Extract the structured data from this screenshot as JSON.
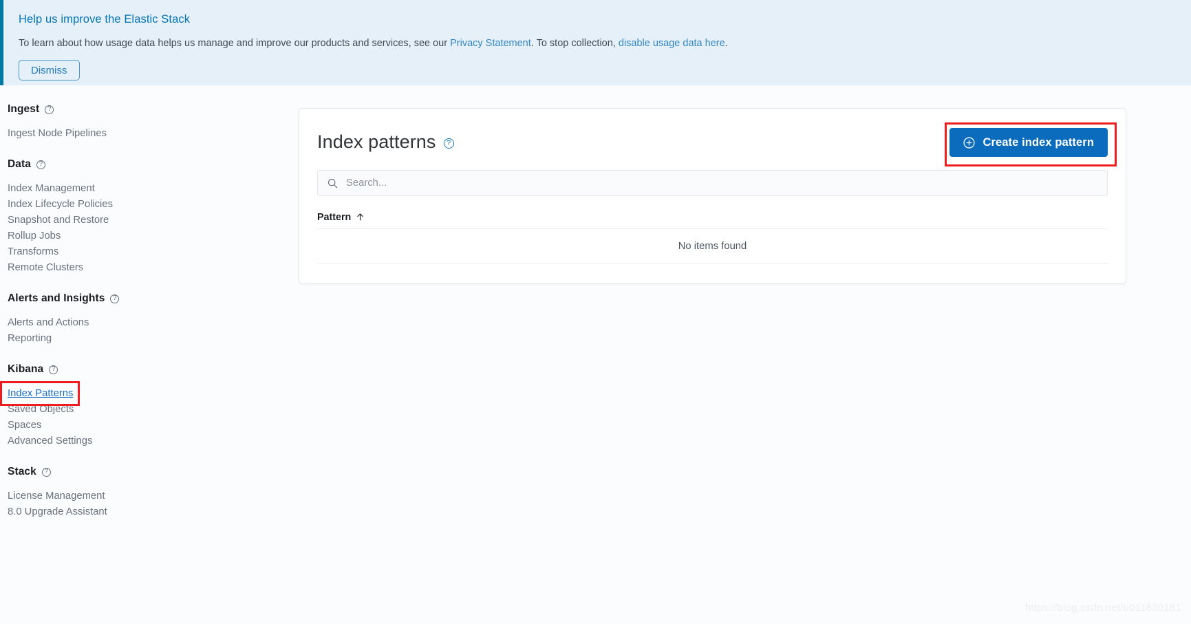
{
  "banner": {
    "title": "Help us improve the Elastic Stack",
    "body_prefix": "To learn about how usage data helps us manage and improve our products and services, see our ",
    "link1": "Privacy Statement",
    "body_middle": ". To stop collection, ",
    "link2": "disable usage data here",
    "body_suffix": ".",
    "dismiss_label": "Dismiss",
    "accent_color": "#0079a5",
    "background_color": "#e6f0f8"
  },
  "sidebar": {
    "groups": [
      {
        "heading": "Ingest",
        "help_icon": "question-circle-icon",
        "items": [
          {
            "label": "Ingest Node Pipelines",
            "active": false
          }
        ]
      },
      {
        "heading": "Data",
        "help_icon": "question-circle-icon",
        "items": [
          {
            "label": "Index Management",
            "active": false
          },
          {
            "label": "Index Lifecycle Policies",
            "active": false
          },
          {
            "label": "Snapshot and Restore",
            "active": false
          },
          {
            "label": "Rollup Jobs",
            "active": false
          },
          {
            "label": "Transforms",
            "active": false
          },
          {
            "label": "Remote Clusters",
            "active": false
          }
        ]
      },
      {
        "heading": "Alerts and Insights",
        "help_icon": "question-circle-icon",
        "items": [
          {
            "label": "Alerts and Actions",
            "active": false
          },
          {
            "label": "Reporting",
            "active": false
          }
        ]
      },
      {
        "heading": "Kibana",
        "help_icon": "question-circle-icon",
        "items": [
          {
            "label": "Index Patterns",
            "active": true
          },
          {
            "label": "Saved Objects",
            "active": false
          },
          {
            "label": "Spaces",
            "active": false
          },
          {
            "label": "Advanced Settings",
            "active": false
          }
        ]
      },
      {
        "heading": "Stack",
        "help_icon": "question-circle-icon",
        "items": [
          {
            "label": "License Management",
            "active": false
          },
          {
            "label": "8.0 Upgrade Assistant",
            "active": false
          }
        ]
      }
    ]
  },
  "main": {
    "title": "Index patterns",
    "title_help_icon": "question-circle-icon",
    "create_button": {
      "label": "Create index pattern",
      "icon": "plus-circle-icon",
      "color": "#0b6cbe"
    },
    "search": {
      "placeholder": "Search...",
      "value": "",
      "icon": "search-icon"
    },
    "table": {
      "columns": [
        {
          "label": "Pattern",
          "sort": "asc",
          "sort_icon": "arrow-up-icon"
        }
      ],
      "rows": [],
      "empty_message": "No items found"
    }
  },
  "annotations": {
    "highlight_color": "#ef1d1d",
    "highlighted_elements": [
      "Index Patterns",
      "Create index pattern"
    ]
  },
  "watermark": "https://blog.csdn.net/u011830181"
}
